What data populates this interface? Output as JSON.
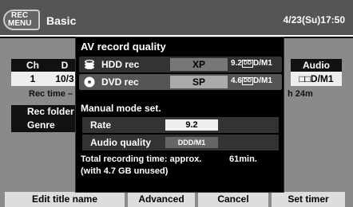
{
  "header": {
    "icon_line1": "REC",
    "icon_line2": "MENU",
    "title": "Basic",
    "datetime": "4/23(Su)17:50"
  },
  "background": {
    "columns": [
      "Ch",
      "D",
      "Audio"
    ],
    "row_values": [
      "1",
      "10/3",
      "□□D/M1"
    ],
    "rec_time": "Rec time –",
    "rec_time_right": "h 24m",
    "side_buttons": [
      "Rec folder",
      "Genre"
    ]
  },
  "popup": {
    "title": "AV record quality",
    "hdd": {
      "label": "HDD rec",
      "mode": "XP",
      "value": "9.2",
      "cap": "D/M1"
    },
    "dvd": {
      "label": "DVD rec",
      "mode": "SP",
      "value": "4.6",
      "cap": "D/M1"
    },
    "manual": {
      "title": "Manual mode set.",
      "rate_label": "Rate",
      "rate_value": "9.2",
      "audio_label": "Audio quality",
      "audio_value": "D/M1"
    },
    "info_line1": "Total recording time: approx.",
    "info_minutes": "61min.",
    "info_line2": "(with 4.7 GB unused)"
  },
  "bottom_bar": {
    "edit": "Edit title name",
    "advanced": "Advanced",
    "cancel": "Cancel",
    "set_timer": "Set timer"
  },
  "colors": {
    "header_bg": "#555555",
    "content_bg": "#8a8a8a",
    "popup_bg": "#000000",
    "selected_row": "#555555"
  },
  "icons": [
    "rec-menu-icon",
    "hdd-icon",
    "dvd-disc-icon"
  ]
}
